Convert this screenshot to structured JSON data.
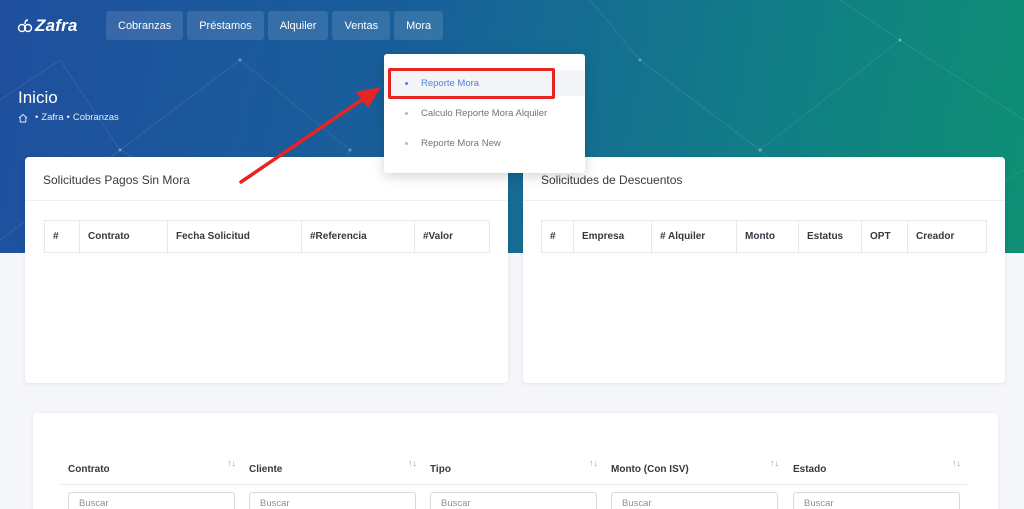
{
  "app": {
    "logo_text": "Zafra"
  },
  "nav": {
    "items": [
      {
        "label": "Cobranzas"
      },
      {
        "label": "Préstamos"
      },
      {
        "label": "Alquiler"
      },
      {
        "label": "Ventas"
      },
      {
        "label": "Mora"
      }
    ]
  },
  "page": {
    "title": "Inicio",
    "breadcrumb": [
      "Zafra",
      "Cobranzas"
    ],
    "breadcrumb_sep": "•"
  },
  "dropdown": {
    "items": [
      {
        "label": "Reporte Mora",
        "active": true
      },
      {
        "label": "Calculo Reporte Mora Alquiler",
        "active": false
      },
      {
        "label": "Reporte Mora New",
        "active": false
      }
    ]
  },
  "card_left": {
    "title": "Solicitudes Pagos Sin Mora",
    "columns": [
      "#",
      "Contrato",
      "Fecha Solicitud",
      "#Referencia",
      "#Valor"
    ]
  },
  "card_right": {
    "title": "Solicitudes de Descuentos",
    "columns": [
      "#",
      "Empresa",
      "# Alquiler",
      "Monto",
      "Estatus",
      "OPT",
      "Creador"
    ]
  },
  "main_table": {
    "columns": [
      "Contrato",
      "Cliente",
      "Tipo",
      "Monto (Con ISV)",
      "Estado"
    ],
    "sort_glyph": "↑↓",
    "search_placeholder": "Buscar"
  },
  "colors": {
    "highlight": "#e62424",
    "accent": "#4f7fd9"
  },
  "icons": {
    "logo": "zafra-logo-icon",
    "home": "home-icon"
  }
}
